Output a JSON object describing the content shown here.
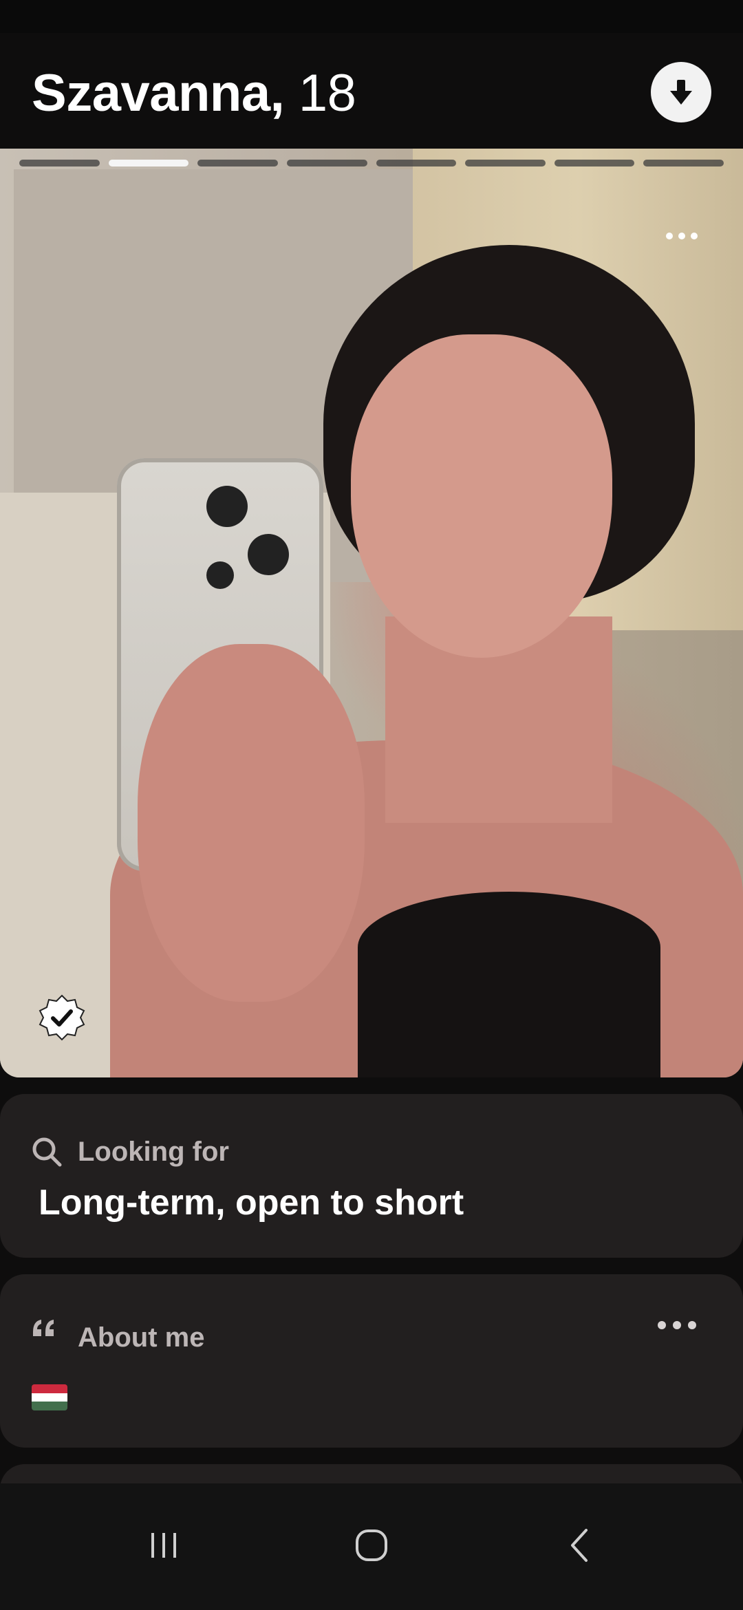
{
  "profile": {
    "name": "Szavanna,",
    "age": "18",
    "photo_count": 8,
    "active_photo_index": 1
  },
  "looking_for": {
    "label": "Looking for",
    "value": "Long-term, open to short"
  },
  "about_me": {
    "label": "About me",
    "flag": "🇭🇺"
  },
  "icons": {
    "collapse": "arrow-down-icon",
    "photo_more": "more-horizontal-icon",
    "verified": "verified-badge-icon",
    "search": "search-icon",
    "quote": "quote-icon",
    "about_more": "more-horizontal-icon",
    "nav_recents": "recents-icon",
    "nav_home": "home-icon",
    "nav_back": "back-icon"
  },
  "colors": {
    "background": "#0e0d0d",
    "card": "#221f1f",
    "label": "#bdb6b6",
    "flag_red": "#cd2a3e",
    "flag_white": "#ffffff",
    "flag_green": "#436f4d"
  }
}
